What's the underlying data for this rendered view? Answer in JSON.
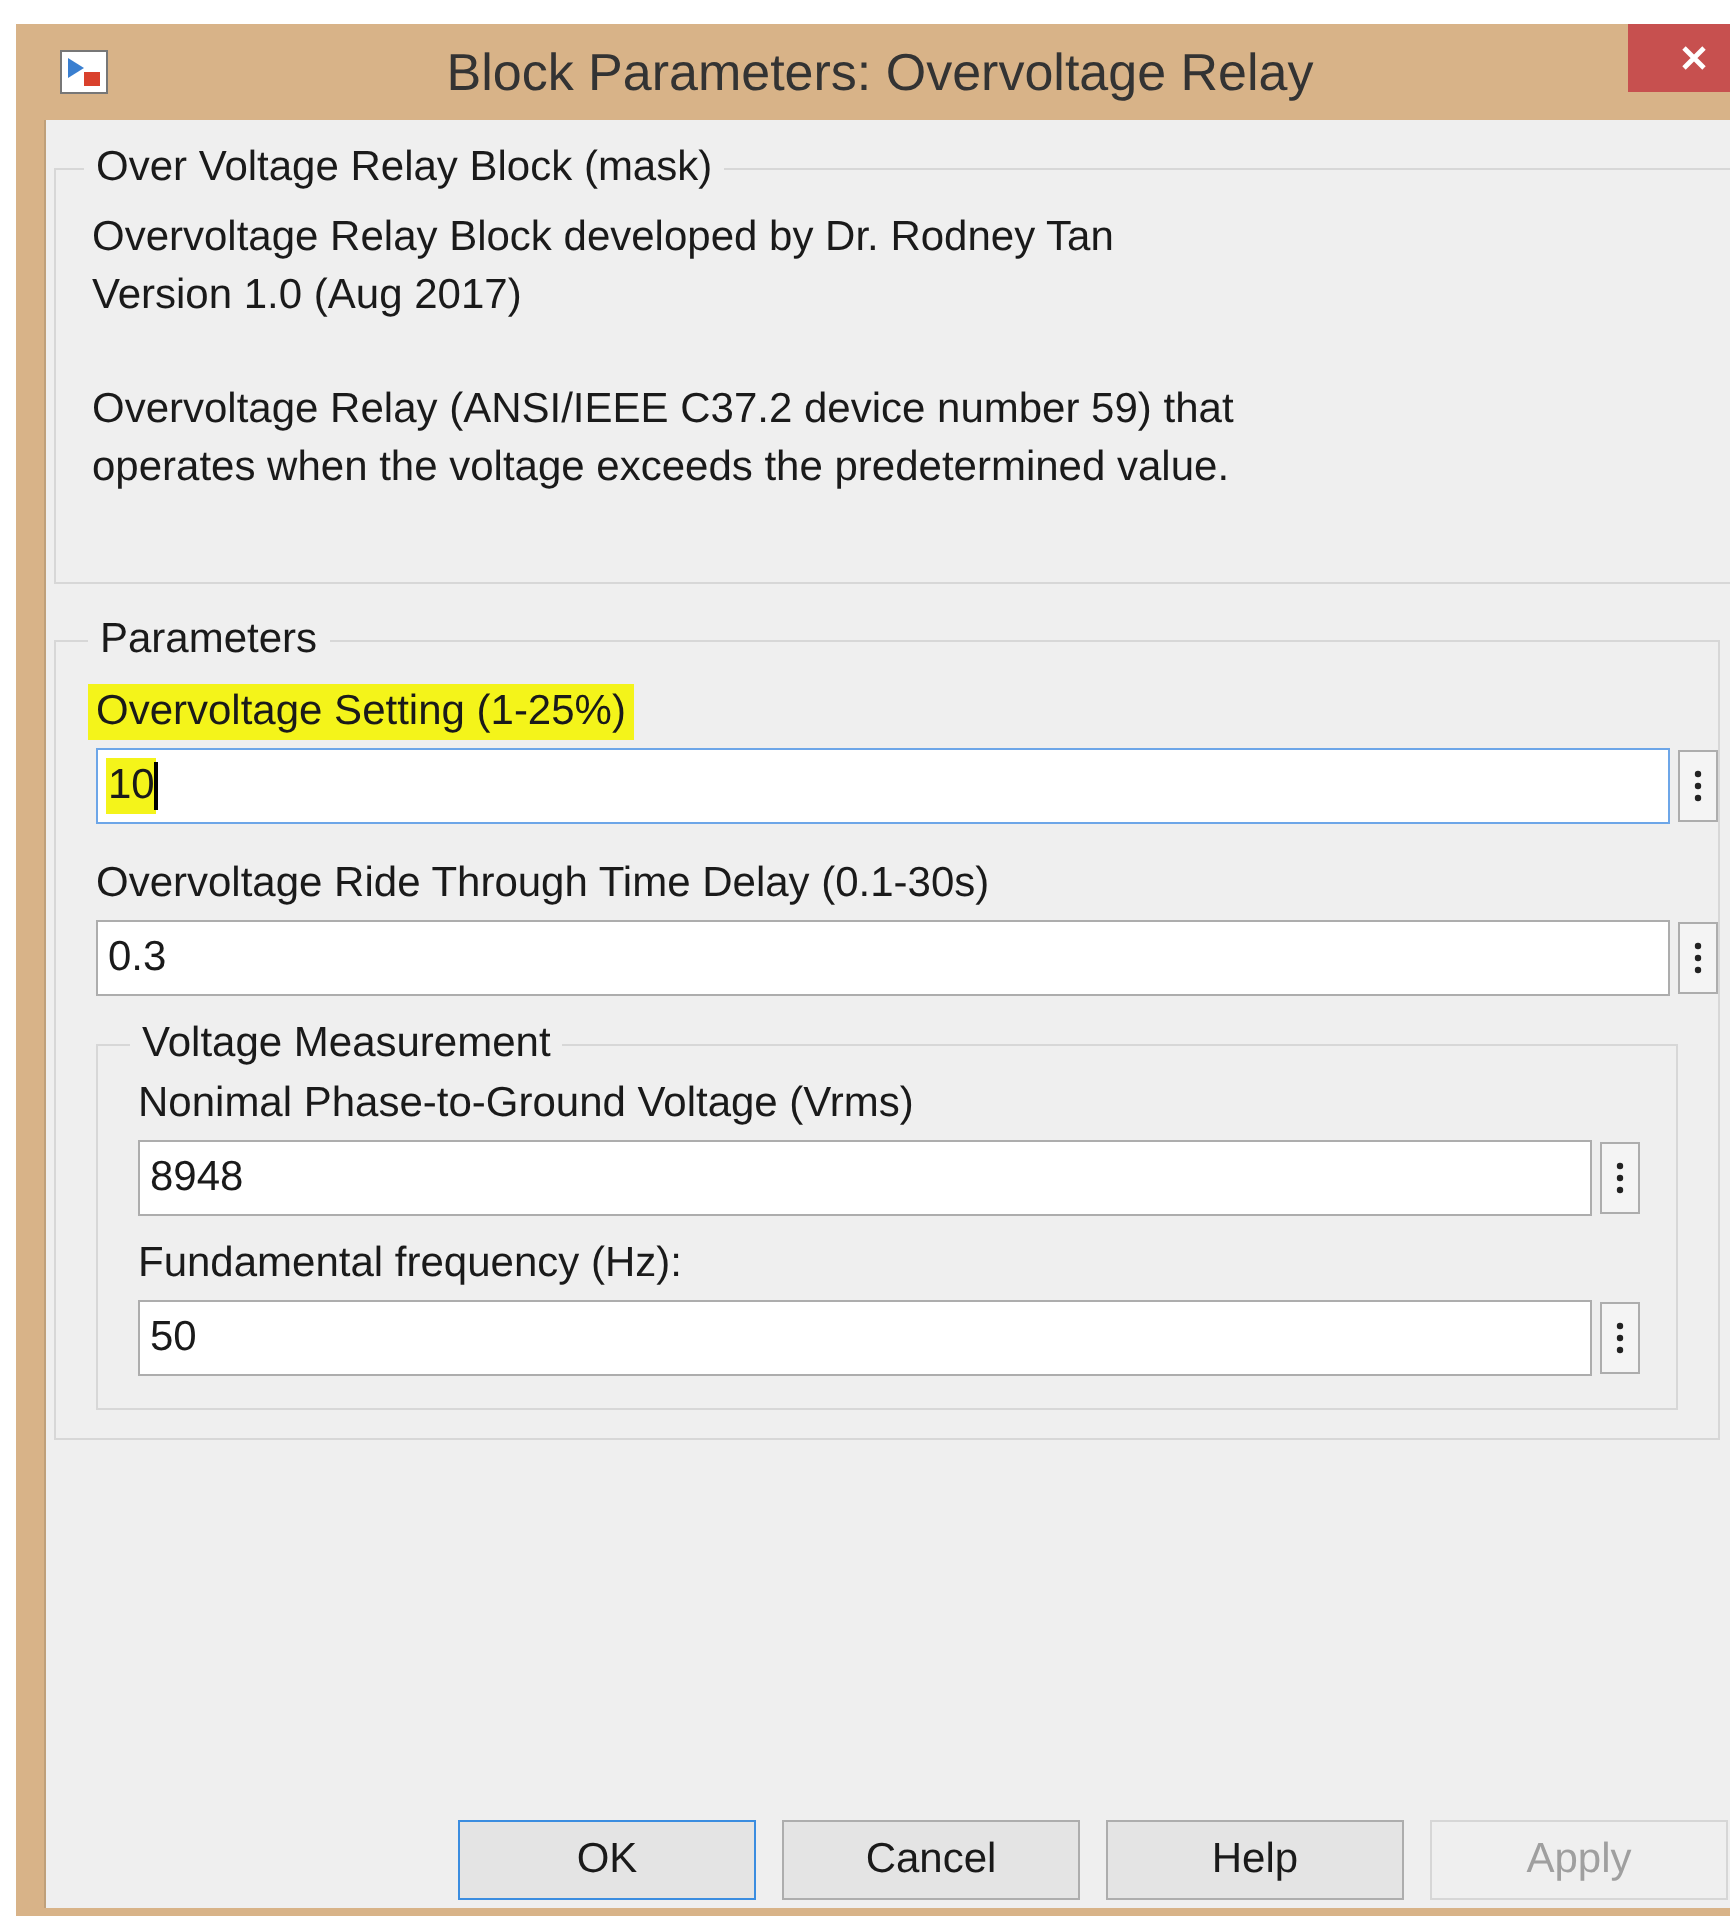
{
  "window": {
    "title": "Block Parameters: Overvoltage Relay"
  },
  "mask": {
    "title": "Over Voltage Relay Block (mask)",
    "text": "Overvoltage Relay Block developed by Dr. Rodney Tan\nVersion 1.0 (Aug 2017)",
    "description": "Overvoltage Relay (ANSI/IEEE C37.2 device number 59) that\noperates when the voltage exceeds the predetermined value."
  },
  "parameters": {
    "title": "Parameters",
    "fields": [
      {
        "label": "Overvoltage Setting (1-25%)",
        "value": "10",
        "highlighted": true,
        "focused": true
      },
      {
        "label": "Overvoltage Ride Through Time Delay (0.1-30s)",
        "value": "0.3",
        "highlighted": false,
        "focused": false
      }
    ],
    "groups": [
      {
        "title": "Voltage Measurement",
        "fields": [
          {
            "label": "Nonimal Phase-to-Ground Voltage (Vrms)",
            "value": "8948",
            "highlighted": false,
            "focused": false
          },
          {
            "label": "Fundamental frequency (Hz):",
            "value": "50",
            "highlighted": false,
            "focused": false
          }
        ]
      }
    ]
  },
  "buttons": [
    {
      "label": "OK",
      "focused": true,
      "disabled": false
    },
    {
      "label": "Cancel",
      "focused": false,
      "disabled": false
    },
    {
      "label": "Help",
      "focused": false,
      "disabled": false
    },
    {
      "label": "Apply",
      "focused": false,
      "disabled": true
    }
  ]
}
